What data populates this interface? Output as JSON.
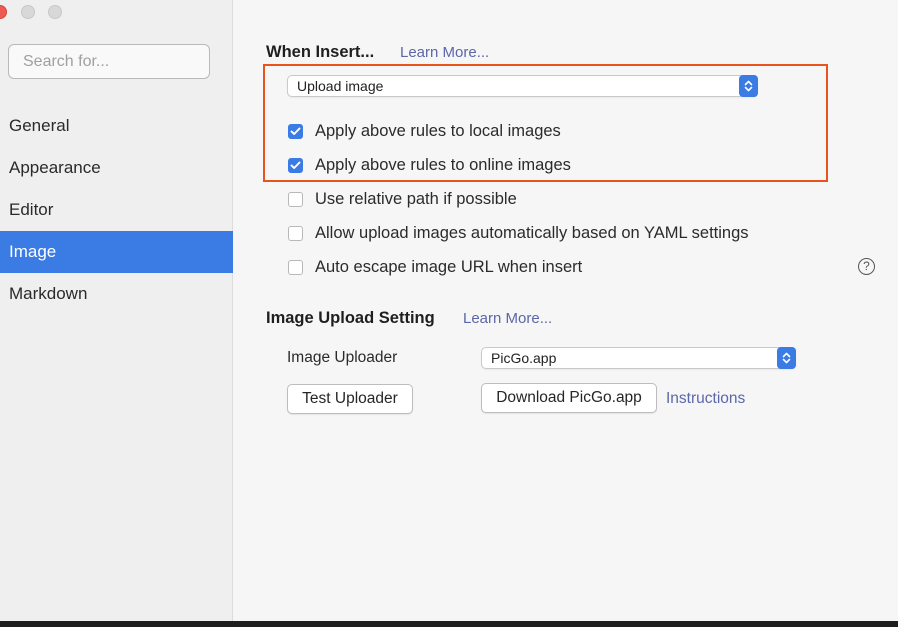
{
  "sidebar": {
    "search_placeholder": "Search for...",
    "items": [
      {
        "label": "General",
        "active": false
      },
      {
        "label": "Appearance",
        "active": false
      },
      {
        "label": "Editor",
        "active": false
      },
      {
        "label": "Image",
        "active": true
      },
      {
        "label": "Markdown",
        "active": false
      }
    ]
  },
  "when_insert": {
    "title": "When Insert...",
    "learn_more": "Learn More...",
    "action_select": "Upload image",
    "options": [
      {
        "label": "Apply above rules to local images",
        "checked": true
      },
      {
        "label": "Apply above rules to online images",
        "checked": true
      },
      {
        "label": "Use relative path if possible",
        "checked": false
      },
      {
        "label": "Allow upload images automatically based on YAML settings",
        "checked": false
      },
      {
        "label": "Auto escape image URL when insert",
        "checked": false
      }
    ]
  },
  "upload_setting": {
    "title": "Image Upload Setting",
    "learn_more": "Learn More...",
    "uploader_label": "Image Uploader",
    "uploader_value": "PicGo.app",
    "test_button": "Test Uploader",
    "download_button": "Download PicGo.app",
    "instructions_link": "Instructions"
  },
  "colors": {
    "accent": "#3b7be4",
    "highlight_box": "#e9531e",
    "link": "#5c67a8"
  },
  "icons": {
    "help": "question-circle-icon",
    "stepper": "chevron-up-down-icon",
    "check": "checkmark-icon"
  }
}
